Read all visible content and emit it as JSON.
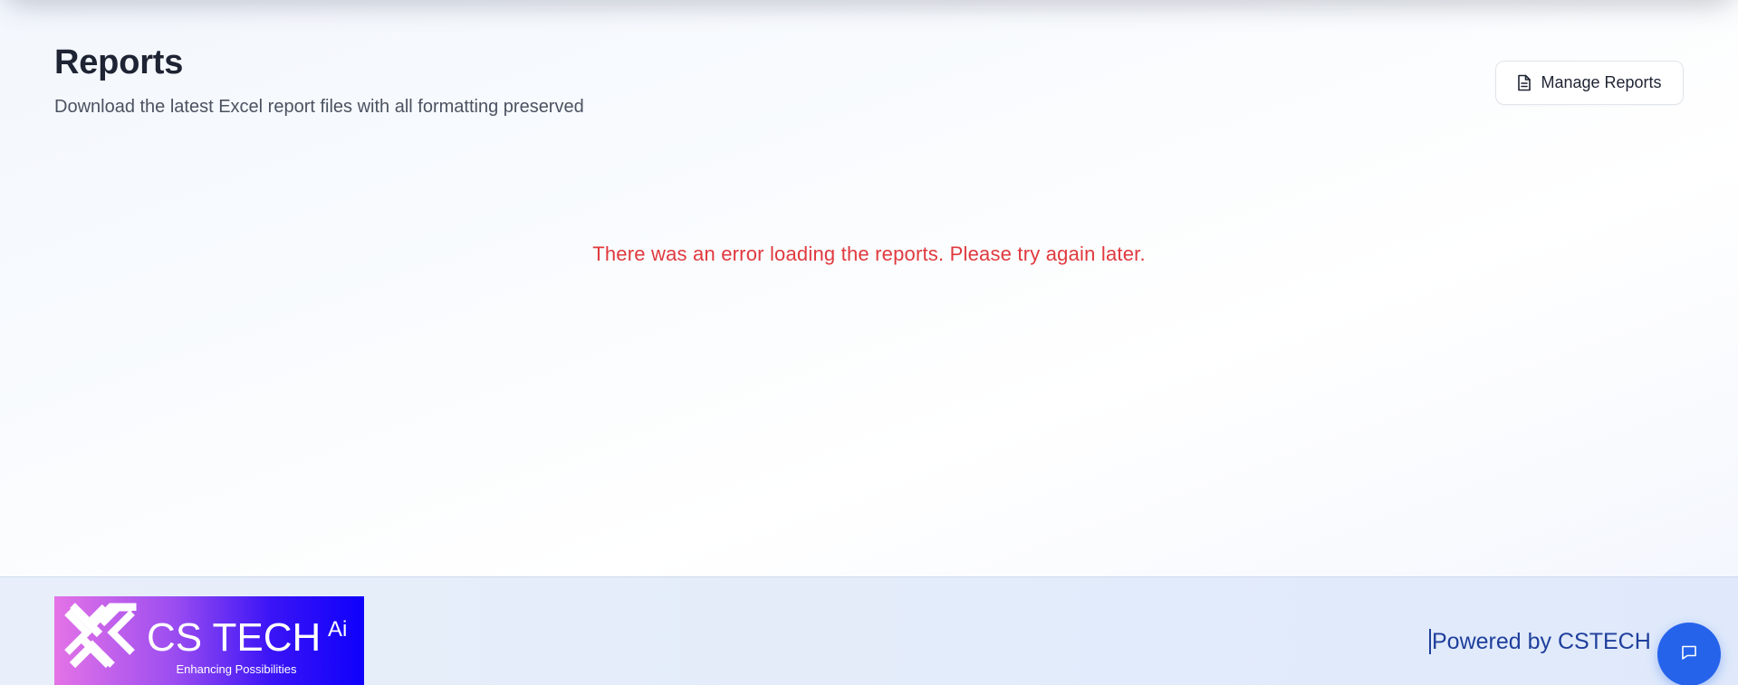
{
  "header": {
    "title": "Reports",
    "subtitle": "Download the latest Excel report files with all formatting preserved",
    "manage_button": {
      "label": "Manage Reports",
      "icon": "document-icon"
    }
  },
  "main": {
    "error_message": "There was an error loading the reports. Please try again later."
  },
  "footer": {
    "logo": {
      "brand": "CS TECH",
      "superscript": "Ai",
      "tagline": "Enhancing Possibilities",
      "icon": "x-mark-logo-icon"
    },
    "powered_by": "Powered by CSTECH"
  },
  "chat_button": {
    "icon": "chat-bubble-icon"
  },
  "colors": {
    "error": "#e0393e",
    "accent": "#2563eb",
    "footer_text": "#1f3f9c",
    "title": "#1e2433"
  }
}
